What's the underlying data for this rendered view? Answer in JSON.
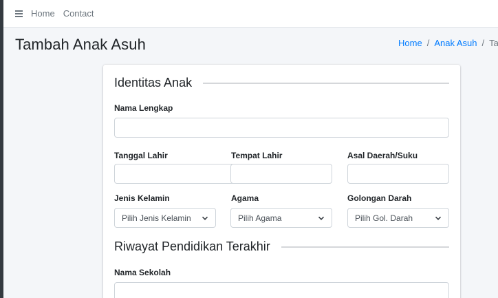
{
  "navbar": {
    "home_label": "Home",
    "contact_label": "Contact"
  },
  "page": {
    "title": "Tambah Anak Asuh"
  },
  "breadcrumb": {
    "items": [
      "Home",
      "Anak Asuh",
      "Tamb"
    ]
  },
  "form": {
    "section_identity": "Identitas Anak",
    "nama_lengkap_label": "Nama Lengkap",
    "nama_lengkap_value": "",
    "tanggal_lahir_label": "Tanggal Lahir",
    "tanggal_lahir_value": "",
    "tempat_lahir_label": "Tempat Lahir",
    "tempat_lahir_value": "",
    "asal_daerah_label": "Asal Daerah/Suku",
    "asal_daerah_value": "",
    "jenis_kelamin_label": "Jenis Kelamin",
    "jenis_kelamin_selected": "Pilih Jenis Kelamin",
    "agama_label": "Agama",
    "agama_selected": "Pilih Agama",
    "golongan_darah_label": "Golongan Darah",
    "golongan_darah_selected": "Pilih Gol. Darah",
    "section_education": "Riwayat Pendidikan Terakhir",
    "nama_sekolah_label": "Nama Sekolah",
    "nama_sekolah_value": ""
  },
  "icons": {
    "menu": "hamburger-icon",
    "calendar": "calendar-icon",
    "chevron": "chevron-down-icon"
  },
  "colors": {
    "link": "#007bff",
    "muted": "#6c757d",
    "border": "#ced4da",
    "background": "#f4f6f9",
    "sidebar_edge": "#343a40"
  }
}
